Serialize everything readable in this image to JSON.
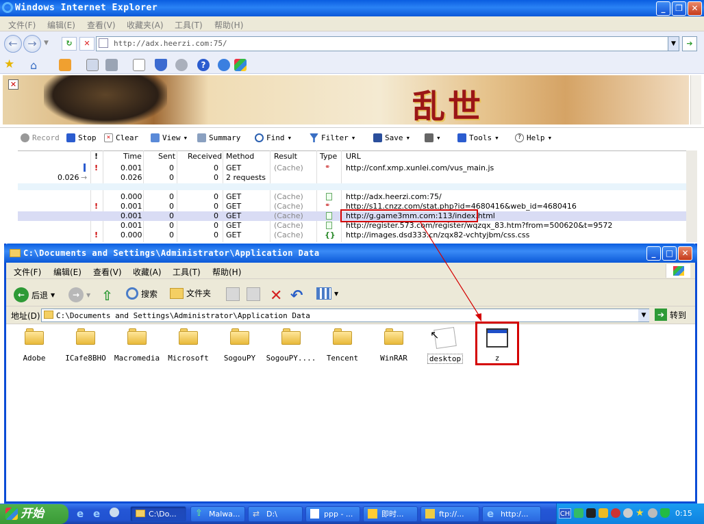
{
  "ie": {
    "title": "Windows Internet Explorer",
    "menu": [
      "文件(F)",
      "编辑(E)",
      "查看(V)",
      "收藏夹(A)",
      "工具(T)",
      "帮助(H)"
    ],
    "address": "http://adx.heerzi.com:75/",
    "banner_title": "乱世"
  },
  "httpwatch": {
    "toolbar": [
      "Record",
      "Stop",
      "Clear",
      "View",
      "Summary",
      "Find",
      "Filter",
      "Save",
      "Tools",
      "Help"
    ],
    "columns": [
      "!",
      "Time",
      "Sent",
      "Received",
      "Method",
      "Result",
      "Type",
      "URL"
    ],
    "rows": [
      {
        "offset": "",
        "flag": "!",
        "time": "0.001",
        "sent": "0",
        "received": "0",
        "method": "GET",
        "result": "(Cache)",
        "url": "http://conf.xmp.xunlei.com/vus_main.js"
      },
      {
        "offset": "0.026",
        "flag": "",
        "time": "0.026",
        "sent": "0",
        "received": "0",
        "method": "2 requests",
        "result": "",
        "url": ""
      },
      {
        "offset": "",
        "flag": "",
        "time": "0.000",
        "sent": "0",
        "received": "0",
        "method": "GET",
        "result": "(Cache)",
        "url": "http://adx.heerzi.com:75/"
      },
      {
        "offset": "",
        "flag": "!",
        "time": "0.001",
        "sent": "0",
        "received": "0",
        "method": "GET",
        "result": "(Cache)",
        "url": "http://s11.cnzz.com/stat.php?id=4680416&web_id=4680416"
      },
      {
        "offset": "",
        "flag": "",
        "time": "0.001",
        "sent": "0",
        "received": "0",
        "method": "GET",
        "result": "(Cache)",
        "url": "http://g.game3mm.com:113/index.html"
      },
      {
        "offset": "",
        "flag": "",
        "time": "0.001",
        "sent": "0",
        "received": "0",
        "method": "GET",
        "result": "(Cache)",
        "url": "http://register.573.com/register/wqzqx_83.htm?from=500620&t=9572"
      },
      {
        "offset": "",
        "flag": "!",
        "time": "0.000",
        "sent": "0",
        "received": "0",
        "method": "GET",
        "result": "(Cache)",
        "url": "http://images.dsd333.cn/zqx82-vchtyjbm/css.css"
      }
    ]
  },
  "explorer": {
    "title": "C:\\Documents and Settings\\Administrator\\Application Data",
    "menu": [
      "文件(F)",
      "编辑(E)",
      "查看(V)",
      "收藏(A)",
      "工具(T)",
      "帮助(H)"
    ],
    "back_label": "后退",
    "search_label": "搜索",
    "folders_label": "文件夹",
    "address_label": "地址(D)",
    "address": "C:\\Documents and Settings\\Administrator\\Application Data",
    "go_label": "转到",
    "items": [
      "Adobe",
      "ICafe8BHO",
      "Macromedia",
      "Microsoft",
      "SogouPY",
      "SogouPY....",
      "Tencent",
      "WinRAR",
      "desktop",
      "z"
    ]
  },
  "taskbar": {
    "start_label": "开始",
    "tasks": [
      "C:\\Do...",
      "Malwa...",
      "D:\\",
      "ppp - ...",
      "即时...",
      "ftp://...",
      "http:/..."
    ],
    "lang": "CH",
    "clock": "0:15"
  },
  "colors": {
    "xp_blue": "#0a5de0",
    "highlight_red": "#d40000"
  }
}
